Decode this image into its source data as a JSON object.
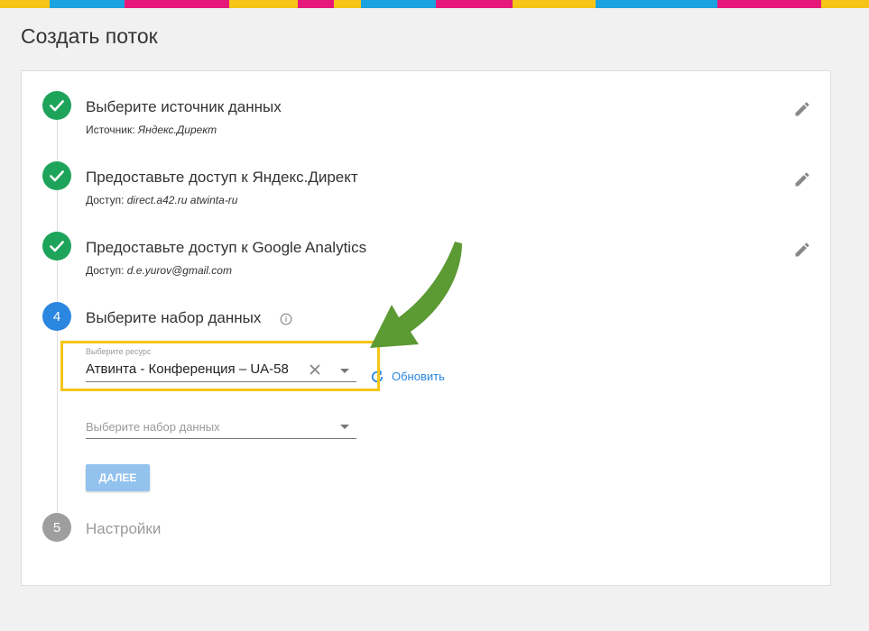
{
  "stripe_colors": [
    "#f5c518",
    "#1ba3e0",
    "#e6197a",
    "#f5c518",
    "#e6197a",
    "#f5c518",
    "#1ba3e0",
    "#e6197a",
    "#f5c518",
    "#1ba3e0",
    "#e6197a",
    "#f5c518"
  ],
  "page": {
    "title": "Создать поток"
  },
  "steps": [
    {
      "number": "1",
      "title": "Выберите источник данных",
      "sub_label": "Источник:",
      "sub_value": "Яндекс.Директ"
    },
    {
      "number": "2",
      "title": "Предоставьте доступ к Яндекс.Директ",
      "sub_label": "Доступ:",
      "sub_value": "direct.a42.ru atwinta-ru"
    },
    {
      "number": "3",
      "title": "Предоставьте доступ к Google Analytics",
      "sub_label": "Доступ:",
      "sub_value": "d.e.yurov@gmail.com"
    },
    {
      "number": "4",
      "title": "Выберите набор данных"
    },
    {
      "number": "5",
      "title": "Настройки"
    }
  ],
  "resource_field": {
    "label": "Выберите ресурс",
    "value": "Атвинта - Конференция – UA-58"
  },
  "refresh": {
    "label": "Обновить"
  },
  "dataset_field": {
    "placeholder": "Выберите набор данных"
  },
  "next_button": {
    "label": "ДАЛЕЕ"
  },
  "colors": {
    "done": "#1ea35b",
    "active": "#2b86e0",
    "pending": "#9e9e9e",
    "highlight": "#f5c518",
    "arrow": "#5c9a34",
    "link": "#2b86e0"
  },
  "icons": {
    "done": "check-icon",
    "edit": "pencil-icon",
    "info": "info-icon",
    "clear": "close-icon",
    "dropdown": "caret-down-icon",
    "refresh": "refresh-icon"
  }
}
